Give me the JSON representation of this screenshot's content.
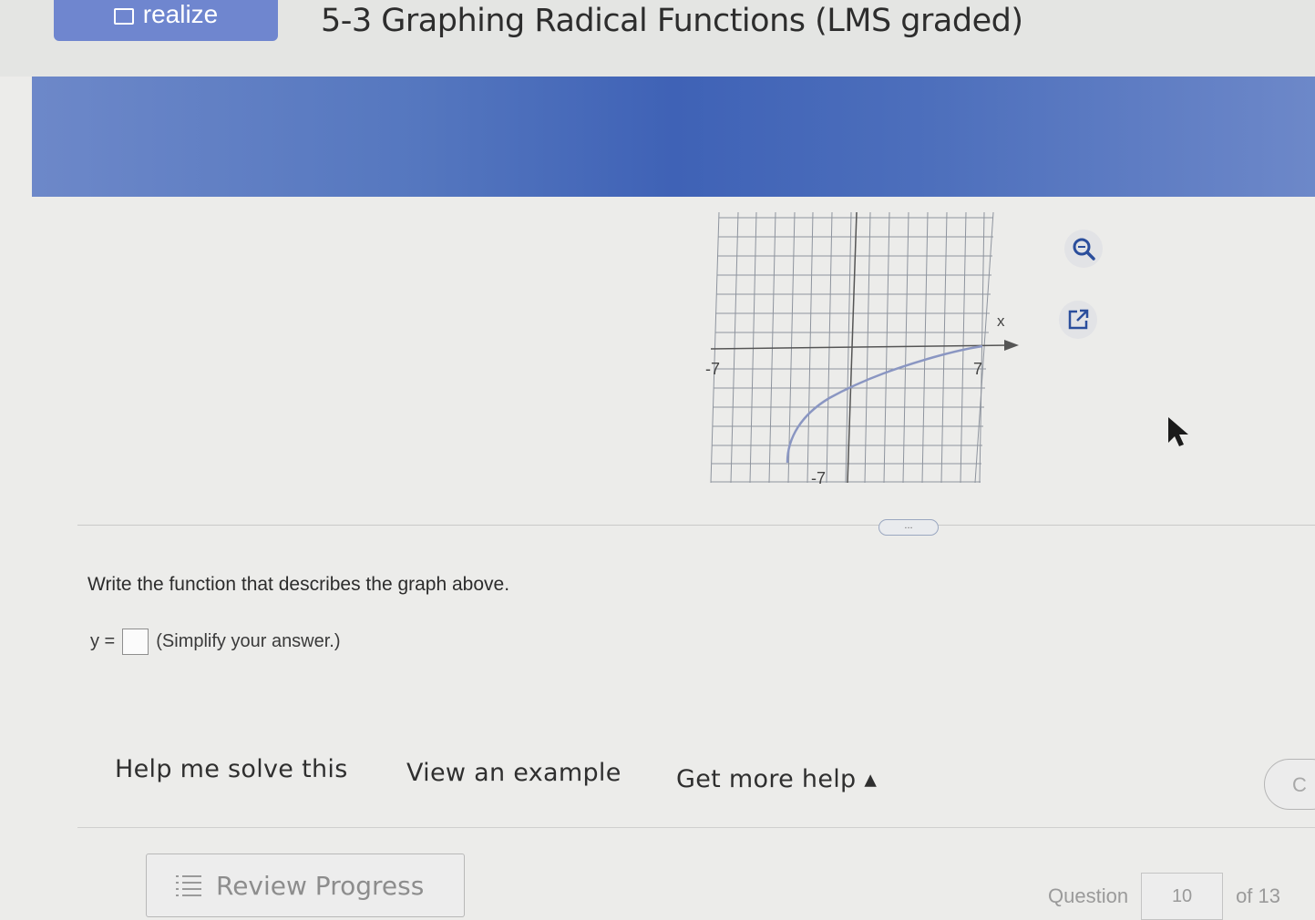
{
  "header": {
    "realize_label": "realize",
    "title": "5-3 Graphing Radical Functions (LMS graded)"
  },
  "graph": {
    "x_axis_label": "x",
    "x_min_label": "-7",
    "x_max_label": "7",
    "y_min_label": "-7"
  },
  "toolbar": {
    "zoom_icon": "zoom-icon",
    "popout_icon": "popout-icon"
  },
  "divider": {
    "more_label": "..."
  },
  "question": {
    "prompt": "Write the function that describes the graph above.",
    "answer_prefix": "y =",
    "answer_value": "",
    "answer_hint": "(Simplify your answer.)"
  },
  "help": {
    "solve_label": "Help me solve this",
    "example_label": "View an example",
    "more_label": "Get more help ▴",
    "check_label": "C"
  },
  "footer": {
    "review_label": "Review Progress",
    "question_label": "Question",
    "question_number": "10",
    "question_total": "of 13"
  },
  "colors": {
    "banner": "#4a6cbb",
    "realize_button": "#6f86cf",
    "curve": "#8a96c2"
  }
}
